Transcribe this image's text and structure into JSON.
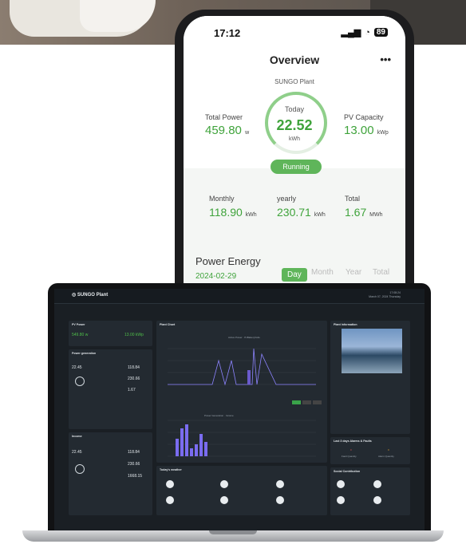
{
  "phone": {
    "status": {
      "time": "17:12",
      "battery": "89"
    },
    "title": "Overview",
    "more": "•••",
    "plant_name": "SUNGO Plant",
    "total_power": {
      "label": "Total Power",
      "value": "459.80",
      "unit": "w"
    },
    "today": {
      "label": "Today",
      "value": "22.52",
      "unit": "kWh"
    },
    "pv_capacity": {
      "label": "PV Capacity",
      "value": "13.00",
      "unit": "kWp"
    },
    "running": "Running",
    "monthly": {
      "label": "Monthly",
      "value": "118.90",
      "unit": "kWh"
    },
    "yearly": {
      "label": "yearly",
      "value": "230.71",
      "unit": "kWh"
    },
    "total": {
      "label": "Total",
      "value": "1.67",
      "unit": "MWh"
    },
    "power_energy": {
      "title": "Power Energy",
      "date": "2024-02-29",
      "tabs": [
        "Day",
        "Month",
        "Year",
        "Total"
      ],
      "active_tab": "Day"
    }
  },
  "laptop": {
    "logo": "SUNGO Plant",
    "datetime_line1": "17:08:24",
    "datetime_line2": "March 07, 2024 Thursday",
    "pv_power": {
      "title": "PV Power",
      "value": "549.80",
      "unit": "w",
      "capacity": "13.00",
      "capacity_unit": "kWp"
    },
    "power_generation": {
      "title": "Power generation",
      "daily": "22.45",
      "monthly": "118.84",
      "yearly": "230.66",
      "total": "1.67"
    },
    "income": {
      "title": "Income",
      "daily": "22.45",
      "monthly": "118.84",
      "yearly": "230.66",
      "total": "1668.15"
    },
    "plant_chart": {
      "title": "Plant Chart",
      "legend": [
        "Active Power",
        "PvBatteryVolts"
      ]
    },
    "bar_legend": [
      "Power Generation",
      "Income"
    ],
    "plant_info": {
      "title": "Plant Information"
    },
    "alarms": {
      "title": "Last 3 days Alarms & Faults",
      "fault": "Fault Quantity",
      "alarm": "Alarm Quantity",
      "fault_val": "0",
      "alarm_val": "0"
    },
    "weather": {
      "title": "Today's weather"
    },
    "social": {
      "title": "Social Contribution"
    }
  }
}
